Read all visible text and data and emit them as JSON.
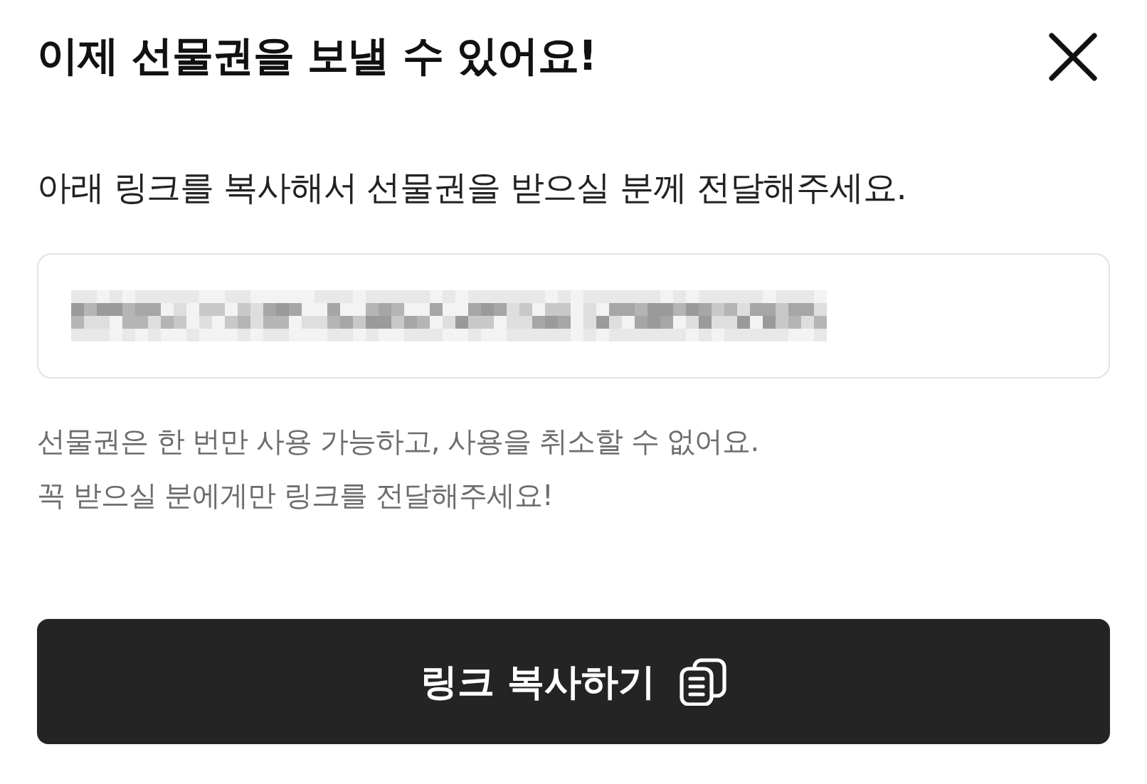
{
  "dialog": {
    "title": "이제 선물권을 보낼 수 있어요!"
  },
  "instruction": "아래 링크를 복사해서 선물권을 받으실 분께 전달해주세요.",
  "link_field": {
    "redacted": true
  },
  "notes": [
    "선물권은 한 번만 사용 가능하고, 사용을 취소할 수 없어요.",
    "꼭 받으실 분에게만 링크를 전달해주세요!"
  ],
  "copy_button": {
    "label": "링크 복사하기"
  }
}
